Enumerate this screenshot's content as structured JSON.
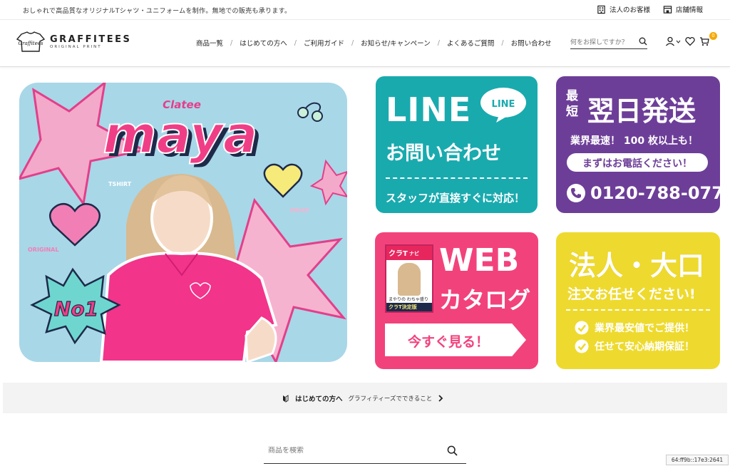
{
  "topbar": {
    "tagline": "おしゃれで高品質なオリジナルTシャツ・ユニフォームを制作。無地での販売も承ります。",
    "corporate_label": "法人のお客様",
    "store_label": "店舗情報"
  },
  "header": {
    "brand": "GRAFFITEES",
    "brand_sub": "ORIGINAL PRINT",
    "logo_script": "Graffitees",
    "nav": [
      "商品一覧",
      "はじめての方へ",
      "ご利用ガイド",
      "お知らせ/キャンペーン",
      "よくあるご質問",
      "お問い合わせ"
    ],
    "search_placeholder": "何をお探しですか？",
    "cart_count": "0"
  },
  "hero": {
    "brand_small": "Clatee",
    "name": "maya",
    "tag_tshirt": "TSHIRT",
    "tag_print": "PRINT",
    "tag_original": "ORIGINAL",
    "badge": "No1"
  },
  "cards": {
    "line": {
      "title": "LINE",
      "bubble": "LINE",
      "subtitle": "お問い合わせ",
      "note": "スタッフが直接すぐに対応！"
    },
    "next_day": {
      "small1": "最",
      "small2": "短",
      "title": "翌日発送",
      "line1": "業界最速！ 100 枚以上も！",
      "pill": "まずはお電話ください！",
      "phone": "0120-788-077"
    },
    "web": {
      "title": "WEB",
      "subtitle": "カタログ",
      "button": "今すぐ見る！",
      "book_title": "クラT",
      "book_sub": "ナビ",
      "book_text": "まやりの わちゃ盛り",
      "book_tag": "クラT決定版"
    },
    "corp": {
      "title": "法人・大口",
      "subtitle": "注文お任せください!",
      "check1": "業界最安値でご提供！",
      "check2": "任せて安心納期保証！"
    }
  },
  "infobar": {
    "title": "はじめての方へ",
    "desc": "グラフィティーズでできること"
  },
  "search_bottom": {
    "placeholder": "商品を検索"
  },
  "ip_label": "64:ff9b::17e3:2641",
  "colors": {
    "line_teal": "#19aaae",
    "next_purple": "#6d3e98",
    "web_pink": "#f2427c",
    "corp_yellow": "#eeda2e",
    "hero_blue": "#a8d7e8",
    "accent_pink": "#f03e86",
    "cart_badge": "#f6a800"
  }
}
